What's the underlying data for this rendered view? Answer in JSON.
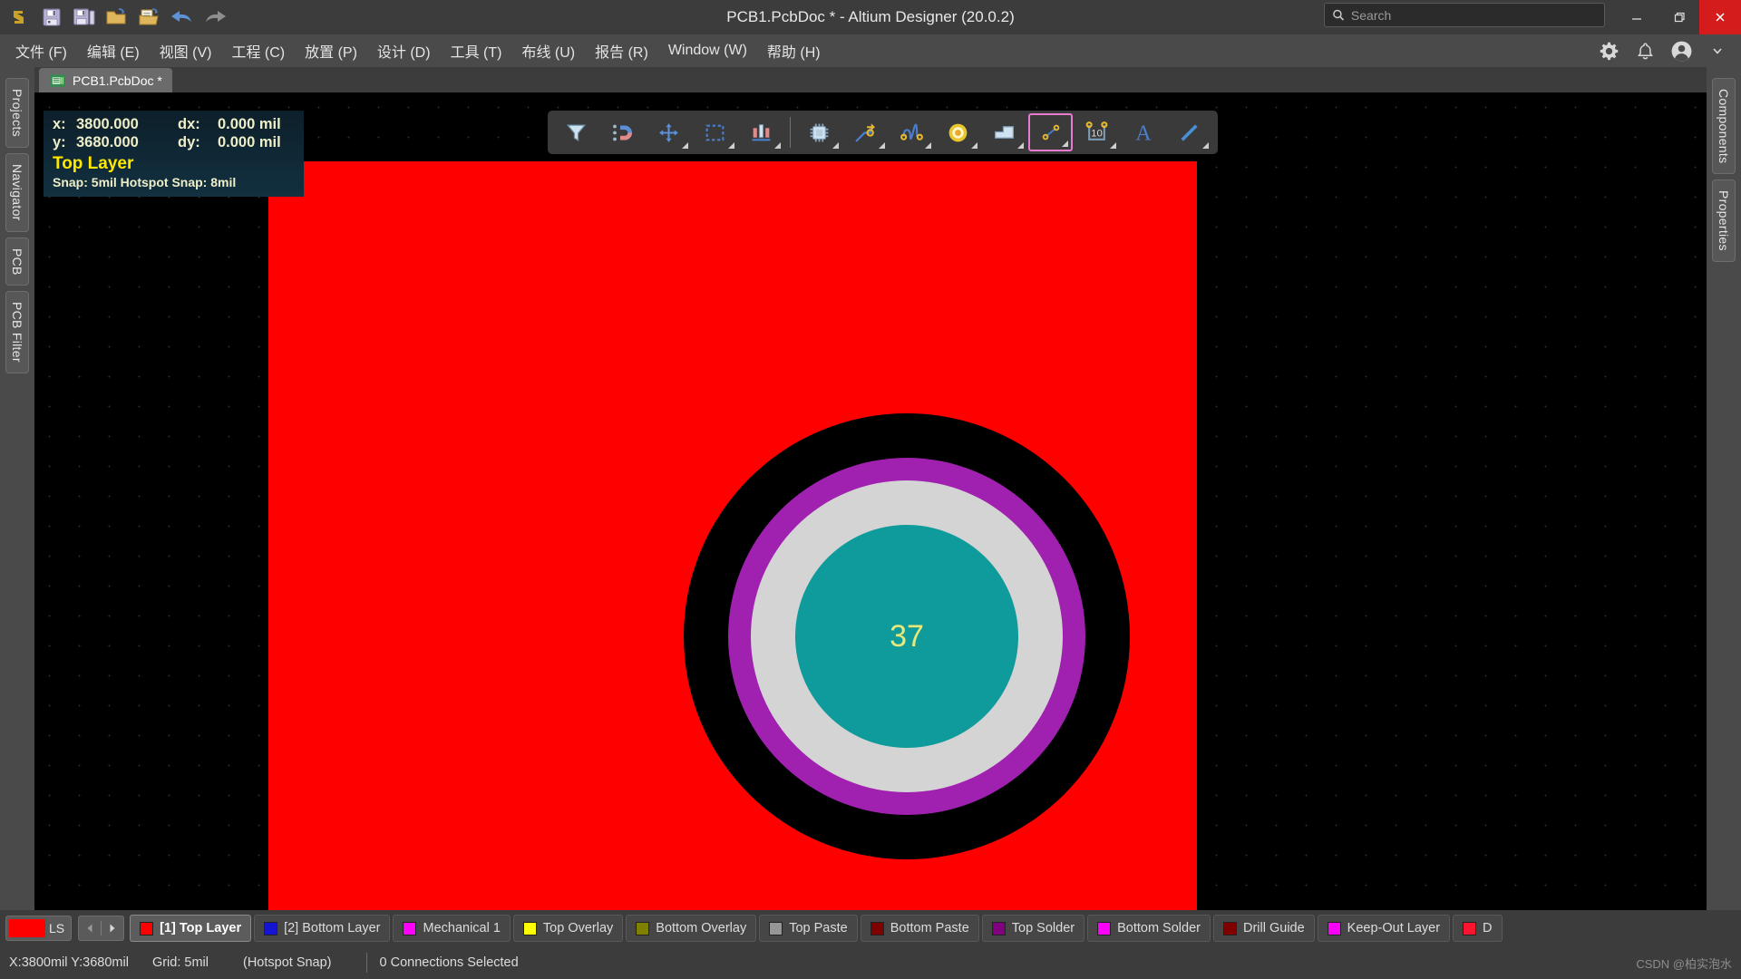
{
  "titlebar": {
    "title": "PCB1.PcbDoc * - Altium Designer (20.0.2)",
    "quick_access": [
      {
        "name": "altium-logo-icon",
        "label": "Altium"
      },
      {
        "name": "save-icon",
        "label": "Save"
      },
      {
        "name": "save-all-icon",
        "label": "Save All"
      },
      {
        "name": "open-icon",
        "label": "Open"
      },
      {
        "name": "open-document-icon",
        "label": "Open Document"
      },
      {
        "name": "undo-icon",
        "label": "Undo"
      },
      {
        "name": "redo-icon",
        "label": "Redo"
      }
    ],
    "window_controls": {
      "minimize": "minimize",
      "restore": "restore",
      "close": "close"
    }
  },
  "search": {
    "placeholder": "Search",
    "value": ""
  },
  "menubar": {
    "items": [
      {
        "label": "文件 (F)"
      },
      {
        "label": "编辑 (E)"
      },
      {
        "label": "视图 (V)"
      },
      {
        "label": "工程 (C)"
      },
      {
        "label": "放置 (P)"
      },
      {
        "label": "设计 (D)"
      },
      {
        "label": "工具 (T)"
      },
      {
        "label": "布线 (U)"
      },
      {
        "label": "报告 (R)"
      },
      {
        "label": "Window (W)"
      },
      {
        "label": "帮助 (H)"
      }
    ],
    "right_icons": [
      {
        "name": "gear-icon",
        "label": "Preferences"
      },
      {
        "name": "bell-icon",
        "label": "Notifications"
      },
      {
        "name": "account-icon",
        "label": "Account"
      },
      {
        "name": "chevron-down-icon",
        "label": "More"
      }
    ]
  },
  "left_dock": {
    "tabs": [
      {
        "label": "Projects"
      },
      {
        "label": "Navigator"
      },
      {
        "label": "PCB"
      },
      {
        "label": "PCB Filter"
      }
    ]
  },
  "right_dock": {
    "tabs": [
      {
        "label": "Components"
      },
      {
        "label": "Properties"
      }
    ]
  },
  "document_tab": {
    "label": "PCB1.PcbDoc *",
    "icon": "pcb-document-icon"
  },
  "hud": {
    "x_key": "x:",
    "x_value": "3800.000",
    "dx_key": "dx:",
    "dx_value": "0.000 mil",
    "y_key": "y:",
    "y_value": "3680.000",
    "dy_key": "dy:",
    "dy_value": "0.000 mil",
    "layer": "Top Layer",
    "snap": "Snap: 5mil Hotspot Snap: 8mil"
  },
  "toolbar": {
    "buttons": [
      {
        "name": "filter-icon",
        "label": "Filter",
        "has_arrow": false,
        "selected": false
      },
      {
        "name": "snap-magnet-icon",
        "label": "Snapping Options",
        "has_arrow": false,
        "selected": false
      },
      {
        "name": "move-icon",
        "label": "Move",
        "has_arrow": true,
        "selected": false
      },
      {
        "name": "select-area-icon",
        "label": "Select Area",
        "has_arrow": true,
        "selected": false
      },
      {
        "name": "align-icon",
        "label": "Align",
        "has_arrow": true,
        "selected": false
      },
      {
        "name": "component-icon",
        "label": "Place Component",
        "has_arrow": true,
        "selected": false
      },
      {
        "name": "route-icon",
        "label": "Interactive Routing",
        "has_arrow": true,
        "selected": false
      },
      {
        "name": "tune-length-icon",
        "label": "Length Tuning",
        "has_arrow": true,
        "selected": false
      },
      {
        "name": "via-icon",
        "label": "Place Via",
        "has_arrow": true,
        "selected": false
      },
      {
        "name": "polygon-icon",
        "label": "Place Polygon",
        "has_arrow": true,
        "selected": false
      },
      {
        "name": "dimension-icon",
        "label": "Place Dimension",
        "has_arrow": true,
        "selected": true
      },
      {
        "name": "net-number-icon",
        "label": "Net Number",
        "has_arrow": true,
        "selected": false
      },
      {
        "name": "text-icon",
        "label": "Place Text",
        "has_arrow": false,
        "selected": false
      },
      {
        "name": "line-icon",
        "label": "Place Line",
        "has_arrow": true,
        "selected": false
      }
    ],
    "highlight_color": "#e87ad0"
  },
  "canvas": {
    "board_color": "#ff0000",
    "pad": {
      "number": "37",
      "outer_color": "#000000",
      "solder_ring_color": "#a020b0",
      "pad_color": "#d4d4d4",
      "hole_color": "#0f9b9b",
      "number_color": "#e8e87a"
    }
  },
  "layerbar": {
    "ls_button": {
      "label": "LS",
      "color": "#ff0000"
    },
    "nav_prev": "previous-layer",
    "nav_next": "next-layer",
    "tabs": [
      {
        "label": "[1] Top Layer",
        "color": "#ff0000",
        "active": true
      },
      {
        "label": "[2] Bottom Layer",
        "color": "#1414d2",
        "active": false
      },
      {
        "label": "Mechanical 1",
        "color": "#ff00ff",
        "active": false
      },
      {
        "label": "Top Overlay",
        "color": "#ffff00",
        "active": false
      },
      {
        "label": "Bottom Overlay",
        "color": "#808000",
        "active": false
      },
      {
        "label": "Top Paste",
        "color": "#969696",
        "active": false
      },
      {
        "label": "Bottom Paste",
        "color": "#800000",
        "active": false
      },
      {
        "label": "Top Solder",
        "color": "#800080",
        "active": false
      },
      {
        "label": "Bottom Solder",
        "color": "#ff00ff",
        "active": false
      },
      {
        "label": "Drill Guide",
        "color": "#800000",
        "active": false
      },
      {
        "label": "Keep-Out Layer",
        "color": "#ff00ff",
        "active": false
      },
      {
        "label": "D",
        "color": "#ff1430",
        "active": false
      }
    ]
  },
  "statusbar": {
    "coordinates": "X:3800mil Y:3680mil",
    "grid": "Grid: 5mil",
    "snap_mode": "(Hotspot Snap)",
    "connections": "0 Connections Selected",
    "watermark_prefix": "CSDN @",
    "watermark_name": "柏实泡水"
  }
}
